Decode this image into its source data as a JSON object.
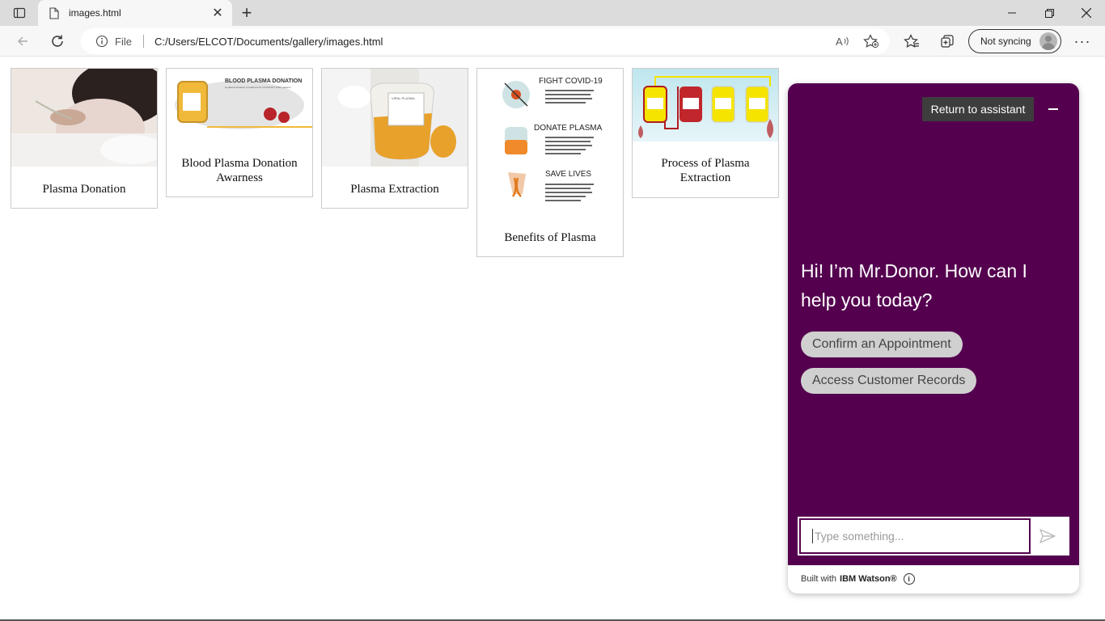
{
  "browser": {
    "tab_title": "images.html",
    "address_prefix": "File",
    "url": "C:/Users/ELCOT/Documents/gallery/images.html",
    "sync_label": "Not syncing",
    "menu_glyph": "···"
  },
  "gallery": {
    "items": [
      {
        "caption": "Plasma Donation"
      },
      {
        "caption": "Blood Plasma Donation Awarness"
      },
      {
        "caption": "Plasma Extraction"
      },
      {
        "caption": "Benefits of Plasma"
      },
      {
        "caption": "Process of Plasma Extraction"
      }
    ],
    "awareness_poster_title": "BLOOD PLASMA DONATION",
    "awareness_poster_subtitle": "Is plasma donation a treatment for COVID-19? Other patients",
    "benefits_poster": {
      "lines": [
        "FIGHT COVID-19",
        "DONATE PLASMA",
        "SAVE LIVES"
      ]
    },
    "bag_label": "VIRAL PLASMA"
  },
  "assistant": {
    "return_label": "Return to assistant",
    "greeting": "Hi! I’m Mr.Donor. How can I help you today?",
    "options": [
      "Confirm an Appointment",
      "Access Customer Records"
    ],
    "input_placeholder": "Type something...",
    "footer_prefix": "Built with",
    "footer_brand": "IBM Watson®",
    "colors": {
      "panel": "#54004f",
      "pill": "#d0d0d0"
    }
  }
}
